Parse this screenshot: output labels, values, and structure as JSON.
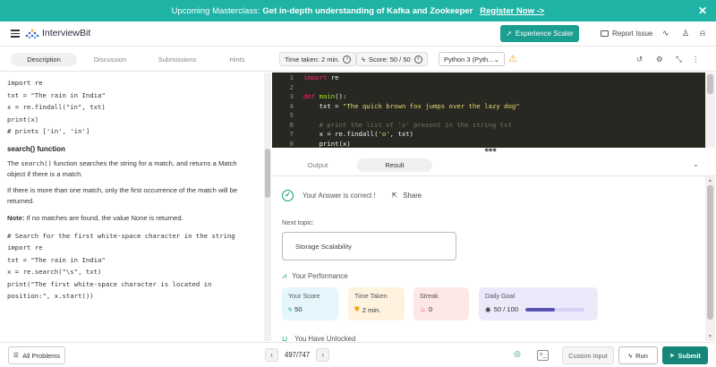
{
  "banner": {
    "prefix": "Upcoming Masterclass:",
    "title": "Get in-depth understanding of Kafka and Zookeeper",
    "cta": "Register Now ->",
    "close": "✕"
  },
  "header": {
    "logo_text": "InterviewBit",
    "experience_button": "Experience Scaler",
    "report_issue": "Report Issue"
  },
  "tabs": [
    "Description",
    "Discussion",
    "Submissions",
    "Hints"
  ],
  "toolbar": {
    "time_taken": "Time taken: 2 min.",
    "score": "Score: 50 / 50",
    "language": "Python 3 (Pyth..."
  },
  "description": {
    "code1": [
      "import re",
      "",
      "txt = \"The rain in India\"",
      "x = re.findall(\"in\", txt)",
      "print(x)",
      "# prints ['in', 'in']"
    ],
    "search_heading": "search() function",
    "search_desc_pre": "The ",
    "search_desc_code": "search()",
    "search_desc_post": " function searches the string for a match, and returns a Match object if there is a match.",
    "multiple_match": "If there is more than one match, only the first occurrence of the match will be returned.",
    "note_label": "Note:",
    "note_text": " If no matches are found, the value None is returned.",
    "code2": [
      "# Search for the first white-space character in the string",
      "import re",
      "",
      "txt = \"The rain in India\"",
      "x = re.search(\"\\s\", txt)",
      "",
      "print(\"The first white-space character is located in",
      "position:\", x.start())"
    ]
  },
  "editor": {
    "line_numbers": [
      "1",
      "2",
      "3",
      "4",
      "5",
      "6",
      "7",
      "8"
    ],
    "l1_kw": "import",
    "l1_rest": " re",
    "l3_kw": "def",
    "l3_fn": " main",
    "l3_rest": "():",
    "l4_pre": "    txt = ",
    "l4_str": "\"The quick brown fox jumps over the lazy dog\"",
    "l6_cm": "    # print the list of 'o' present in the string txt",
    "l7_pre": "    x = re.findall(",
    "l7_str": "'o'",
    "l7_post": ", txt)",
    "l8_pre": "    print(x)"
  },
  "result": {
    "tabs": [
      "Output",
      "Result"
    ],
    "answer_status": "Your Answer is correct !",
    "share": "Share",
    "next_topic_label": "Next topic:",
    "next_topic": "Storage Scalability",
    "performance_title": "Your Performance",
    "cards": {
      "score_label": "Your Score",
      "score_value": "50",
      "time_label": "Time Taken",
      "time_value": "2 min.",
      "streak_label": "Streak",
      "streak_value": "0",
      "goal_label": "Daily Goal",
      "goal_value": "50 / 100",
      "goal_progress": 0.5
    },
    "unlocked": "You Have Unlocked"
  },
  "footer": {
    "all_problems": "All Problems",
    "pager": "497/747",
    "custom_input": "Custom Input",
    "run": "Run",
    "submit": "Submit"
  },
  "colors": {
    "banner": "#1fb3a6",
    "accent": "#1a9e92",
    "submit": "#16867a",
    "editor_bg": "#272822"
  }
}
